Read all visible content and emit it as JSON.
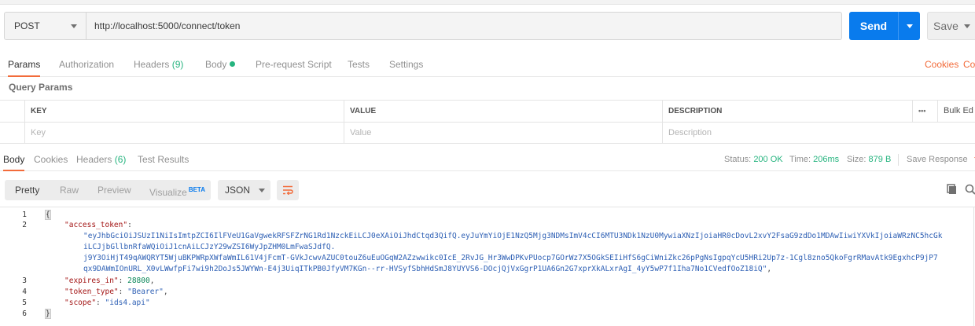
{
  "request": {
    "method": "POST",
    "url": "http://localhost:5000/connect/token",
    "send_label": "Send",
    "save_label": "Save"
  },
  "request_tabs": {
    "params": "Params",
    "authorization": "Authorization",
    "headers": "Headers",
    "headers_count": "(9)",
    "body": "Body",
    "pre_request_script": "Pre-request Script",
    "tests": "Tests",
    "settings": "Settings",
    "cookies": "Cookies",
    "code": "Coc"
  },
  "query_params": {
    "title": "Query Params",
    "columns": {
      "key": "KEY",
      "value": "VALUE",
      "description": "DESCRIPTION"
    },
    "more": "•••",
    "bulk_edit": "Bulk Ed",
    "placeholders": {
      "key": "Key",
      "value": "Value",
      "description": "Description"
    }
  },
  "response_tabs": {
    "body": "Body",
    "cookies": "Cookies",
    "headers": "Headers",
    "headers_count": "(6)",
    "test_results": "Test Results",
    "status_label": "Status:",
    "status_value": "200 OK",
    "time_label": "Time:",
    "time_value": "206ms",
    "size_label": "Size:",
    "size_value": "879 B",
    "save_response": "Save Response"
  },
  "view": {
    "pretty": "Pretty",
    "raw": "Raw",
    "preview": "Preview",
    "visualize": "Visualize",
    "beta": "BETA",
    "format": "JSON"
  },
  "response_body": {
    "lines": [
      {
        "n": "1",
        "open": "{"
      },
      {
        "n": "2",
        "key": "\"access_token\"",
        "colon": ":"
      },
      {
        "str": "\"eyJhbGciOiJSUzI1NiIsImtpZCI6IlFVeU1GaVgwekRFSFZrNG1Rd1NzckEiLCJ0eXAiOiJhdCtqd3QifQ.eyJuYmYiOjE1NzQ5Mjg3NDMsImV4cCI6MTU3NDk1NzU0MywiaXNzIjoiaHR0cDovL2xvY2FsaG9zdDo1MDAwIiwiYXVkIjoiaWRzNC5hcGk"
      },
      {
        "str": "iLCJjbGllbnRfaWQiOiJ1cnAiLCJzY29wZSI6WyJpZHM0LmFwaSJdfQ."
      },
      {
        "str": "j9Y3OiHjT49qAWQRYT5WjuBKPWRpXWfaWmIL61V4jFcmT-GVkJcwvAZUC0touZ6uEuOGqW2AZzwwikc0IcE_2RvJG_Hr3WwDPKvPUocp7GOrWz7X5OGkSEIiHfS6gCiWniZkc26pPgNsIgpqYcU5HRi2Up7z-1Cgl8zno5QkoFgrRMavAtk9EgxhcP9jP7"
      },
      {
        "str": "qx9DAWmIOnURL_X0vLWwfpFi7wi9h2DoJs5JWYWn-E4j3UiqITkPB0JfyVM7KGn--rr-HVSyfSbhHdSmJ8YUYVS6-DOcjQjVxGgrP1UA6Gn2G7xprXkALxrAgI_4yY5wP7f1Iha7No1CVedfOoZ18iQ\"",
        "comma": ","
      },
      {
        "n": "3",
        "key": "\"expires_in\"",
        "colon": ": ",
        "num": "28800",
        "comma": ","
      },
      {
        "n": "4",
        "key": "\"token_type\"",
        "colon": ": ",
        "str": "\"Bearer\"",
        "comma": ","
      },
      {
        "n": "5",
        "key": "\"scope\"",
        "colon": ": ",
        "str": "\"ids4.api\""
      },
      {
        "n": "6",
        "close": "}"
      }
    ]
  },
  "colors": {
    "accent": "#f26b3a",
    "send": "#097bed",
    "success": "#26b47f"
  },
  "icons": [
    "chevron-down-icon",
    "wrap-lines-icon",
    "copy-icon",
    "search-icon"
  ]
}
